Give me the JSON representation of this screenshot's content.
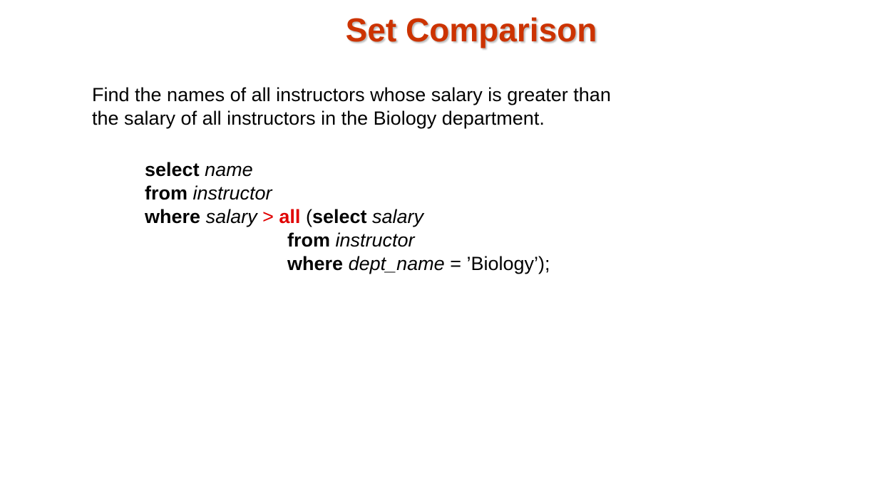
{
  "slide": {
    "title": "Set Comparison",
    "description": {
      "line1": "Find the names of all instructors whose salary is greater than",
      "line2": "the salary of all instructors in the Biology department."
    },
    "query": {
      "line1": {
        "keyword": "select",
        "ident": "name"
      },
      "line2": {
        "keyword": "from",
        "ident": "instructor"
      },
      "line3": {
        "keyword": "where",
        "ident": "salary",
        "operator": ">",
        "quantifier": "all",
        "open_paren": "(",
        "sub_keyword": "select",
        "sub_ident": "salary"
      },
      "line4": {
        "keyword": "from",
        "ident": "instructor"
      },
      "line5": {
        "keyword": "where",
        "ident": "dept_name",
        "rest": "= ’Biology’);"
      }
    },
    "colors": {
      "title": "#cc3300",
      "highlight": "#e00000",
      "text": "#000000",
      "background": "#ffffff"
    }
  }
}
